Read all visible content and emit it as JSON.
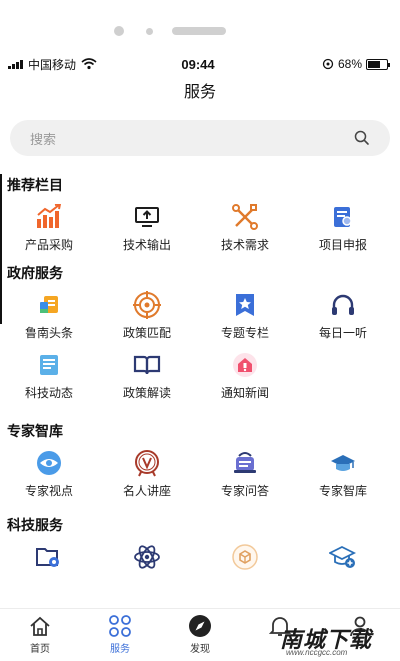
{
  "status_bar": {
    "carrier": "中国移动",
    "time": "09:44",
    "battery": "68%"
  },
  "header": {
    "title": "服务"
  },
  "search": {
    "placeholder": "搜索"
  },
  "sections": [
    {
      "title": "推荐栏目",
      "items": [
        {
          "label": "产品采购",
          "icon": "bar-chart-arrow-icon"
        },
        {
          "label": "技术输出",
          "icon": "monitor-upload-icon"
        },
        {
          "label": "技术需求",
          "icon": "tools-wrench-icon"
        },
        {
          "label": "项目申报",
          "icon": "document-search-icon"
        }
      ]
    },
    {
      "title": "政府服务",
      "items": [
        {
          "label": "鲁南头条",
          "icon": "headline-icon"
        },
        {
          "label": "政策匹配",
          "icon": "target-icon"
        },
        {
          "label": "专题专栏",
          "icon": "star-bookmark-icon"
        },
        {
          "label": "每日一听",
          "icon": "headphones-icon"
        },
        {
          "label": "科技动态",
          "icon": "news-doc-icon"
        },
        {
          "label": "政策解读",
          "icon": "open-book-icon"
        },
        {
          "label": "通知新闻",
          "icon": "bell-notice-icon"
        }
      ]
    },
    {
      "title": "专家智库",
      "items": [
        {
          "label": "专家视点",
          "icon": "eye-icon"
        },
        {
          "label": "名人讲座",
          "icon": "medal-v-icon"
        },
        {
          "label": "专家问答",
          "icon": "qa-icon"
        },
        {
          "label": "专家智库",
          "icon": "graduation-cap-icon"
        }
      ]
    },
    {
      "title": "科技服务",
      "items": [
        {
          "label": "",
          "icon": "folder-gear-icon"
        },
        {
          "label": "",
          "icon": "atom-icon"
        },
        {
          "label": "",
          "icon": "box-circle-icon"
        },
        {
          "label": "",
          "icon": "cap-plus-icon"
        }
      ]
    }
  ],
  "tabs": [
    {
      "label": "首页",
      "icon": "home-icon"
    },
    {
      "label": "服务",
      "icon": "grid-icon"
    },
    {
      "label": "发现",
      "icon": "compass-icon"
    },
    {
      "label": "",
      "icon": "bell-icon"
    },
    {
      "label": "",
      "icon": "user-icon"
    }
  ],
  "watermark": {
    "text": "南城下载",
    "sub": "www.nccgcc.com"
  },
  "colors": {
    "accent": "#3b6fd8",
    "orange": "#f0662c",
    "navy": "#2d3a73"
  }
}
